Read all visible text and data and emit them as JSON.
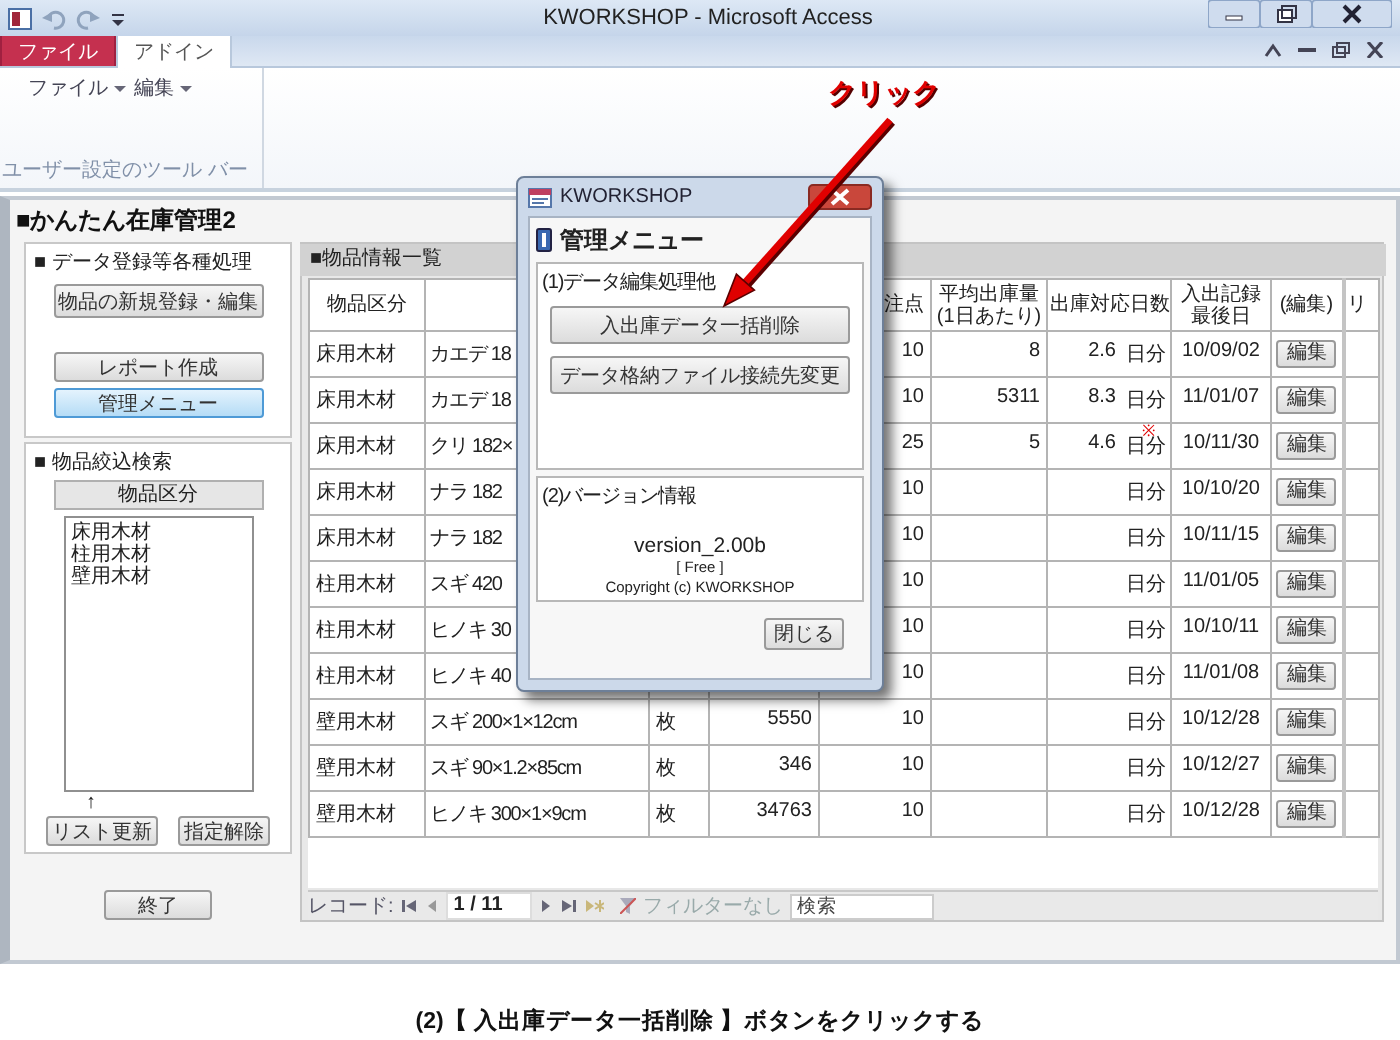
{
  "window": {
    "title": "KWORKSHOP - Microsoft Access"
  },
  "ribbon_tabs": [
    {
      "label": "ファイル",
      "kind": "file",
      "selected": false
    },
    {
      "label": "アドイン",
      "kind": "tab",
      "selected": true
    }
  ],
  "ribbon": {
    "menus": [
      "ファイル",
      "編集"
    ],
    "group_label": "ユーザー設定のツール バー"
  },
  "form": {
    "title": "■かんたん在庫管理2",
    "processing": {
      "heading": "■ データ登録等各種処理",
      "buttons": [
        {
          "label": "物品の新規登録・編集",
          "highlighted": false
        },
        {
          "label": "レポート作成",
          "highlighted": false
        },
        {
          "label": "管理メニュー",
          "highlighted": true
        }
      ]
    },
    "filter": {
      "heading": "■ 物品絞込検索",
      "list_header": "物品区分",
      "items": [
        "床用木材",
        "柱用木材",
        "壁用木材"
      ],
      "hint": "↑",
      "buttons": [
        "リスト更新",
        "指定解除"
      ]
    },
    "exit_button": "終了",
    "list": {
      "heading": "■物品情報一覧",
      "header": {
        "category": [
          "物品区分"
        ],
        "reorder_point": [
          "注点"
        ],
        "avg_out": [
          "平均出庫量",
          "(1日あたり)"
        ],
        "days": [
          "出庫対応日数"
        ],
        "last_date": [
          "入出記録",
          "最後日"
        ],
        "edit": [
          "(編集)"
        ],
        "column_11": [
          "リ"
        ]
      },
      "rows": [
        {
          "category": "床用木材",
          "name": "カエデ 18",
          "reorder_point": "10",
          "avg_out": "8",
          "days": "2.6",
          "days_unit": "日分",
          "last_date": "10/09/02",
          "edit": "編集"
        },
        {
          "category": "床用木材",
          "name": "カエデ 18",
          "reorder_point": "10",
          "avg_out": "5311",
          "days": "8.3",
          "days_unit": "日分",
          "last_date": "11/01/07",
          "edit": "編集"
        },
        {
          "category": "床用木材",
          "name": "クリ 182×",
          "reorder_point": "25",
          "avg_out": "5",
          "days": "4.6",
          "mark": "※",
          "days_unit": "日分",
          "last_date": "10/11/30",
          "edit": "編集"
        },
        {
          "category": "床用木材",
          "name": "ナラ 182",
          "reorder_point": "10",
          "days_unit": "日分",
          "last_date": "10/10/20",
          "edit": "編集"
        },
        {
          "category": "床用木材",
          "name": "ナラ 182",
          "reorder_point": "10",
          "days_unit": "日分",
          "last_date": "10/11/15",
          "edit": "編集"
        },
        {
          "category": "柱用木材",
          "name": "スギ 420",
          "reorder_point": "10",
          "days_unit": "日分",
          "last_date": "11/01/05",
          "edit": "編集"
        },
        {
          "category": "柱用木材",
          "name": "ヒノキ 30",
          "reorder_point": "10",
          "days_unit": "日分",
          "last_date": "10/10/11",
          "edit": "編集"
        },
        {
          "category": "柱用木材",
          "name": "ヒノキ 40",
          "reorder_point": "10",
          "days_unit": "日分",
          "last_date": "11/01/08",
          "edit": "編集"
        },
        {
          "category": "壁用木材",
          "name": "スギ 200×1×12cm",
          "unit": "枚",
          "quantity": "5550",
          "reorder_point": "10",
          "days_unit": "日分",
          "last_date": "10/12/28",
          "edit": "編集"
        },
        {
          "category": "壁用木材",
          "name": "スギ 90×1.2×85cm",
          "unit": "枚",
          "quantity": "346",
          "reorder_point": "10",
          "days_unit": "日分",
          "last_date": "10/12/27",
          "edit": "編集"
        },
        {
          "category": "壁用木材",
          "name": "ヒノキ 300×1×9cm",
          "unit": "枚",
          "quantity": "34763",
          "reorder_point": "10",
          "days_unit": "日分",
          "last_date": "10/12/28",
          "edit": "編集"
        }
      ],
      "navigator": {
        "label": "レコード:",
        "position": "1 / 11",
        "filter": "フィルターなし",
        "search_placeholder": "検索"
      }
    }
  },
  "dialog": {
    "title": "KWORKSHOP",
    "heading": "管理メニュー",
    "group1": {
      "label": "(1)データ編集処理他",
      "buttons": [
        "入出庫データ一括削除",
        "データ格納ファイル接続先変更"
      ]
    },
    "group2": {
      "label": "(2)バージョン情報",
      "version": "version_2.00b",
      "edition": "[ Free ]",
      "copyright": "Copyright (c) KWORKSHOP"
    },
    "close_button": "閉じる"
  },
  "annotation": {
    "callout": "クリック"
  },
  "caption": "(2)【 入出庫データ一括削除 】ボタンをクリックする"
}
